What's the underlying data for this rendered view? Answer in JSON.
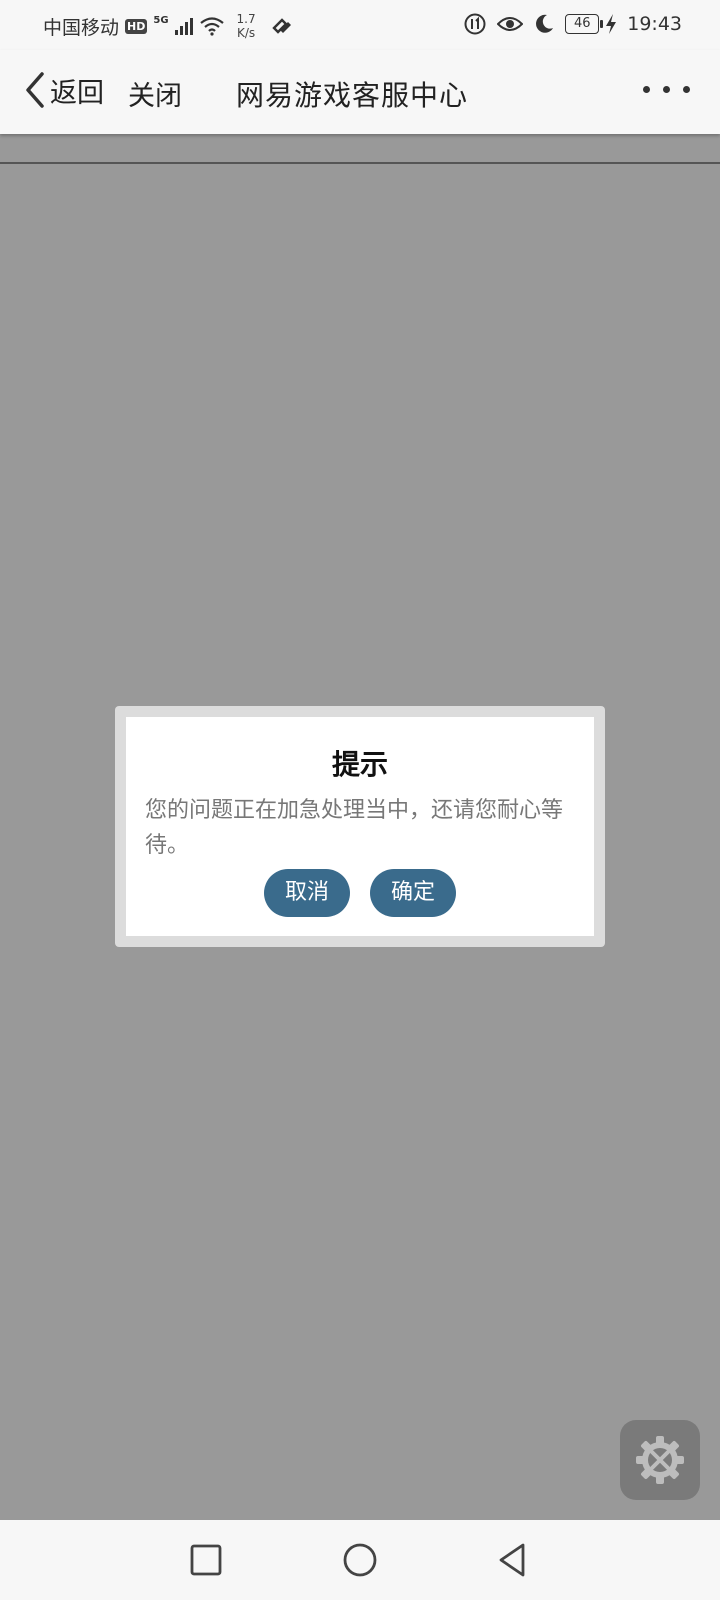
{
  "status_bar": {
    "carrier": "中国移动",
    "hd_badge": "HD",
    "network_type": "5G",
    "speed_value": "1.7",
    "speed_unit": "K/s",
    "battery": "46",
    "time": "19:43"
  },
  "nav": {
    "back_label": "返回",
    "close_label": "关闭",
    "title": "网易游戏客服中心"
  },
  "dialog": {
    "title": "提示",
    "message": "您的问题正在加急处理当中，还请您耐心等待。",
    "cancel_label": "取消",
    "confirm_label": "确定"
  },
  "colors": {
    "overlay": "#999999",
    "dialog_button": "#3a6b8c",
    "bar_background": "#f7f7f7"
  },
  "icons": {
    "floating_tool": "settings-gear-tools-icon",
    "nav_recent": "square-icon",
    "nav_home": "circle-icon",
    "nav_back": "triangle-back-icon"
  }
}
